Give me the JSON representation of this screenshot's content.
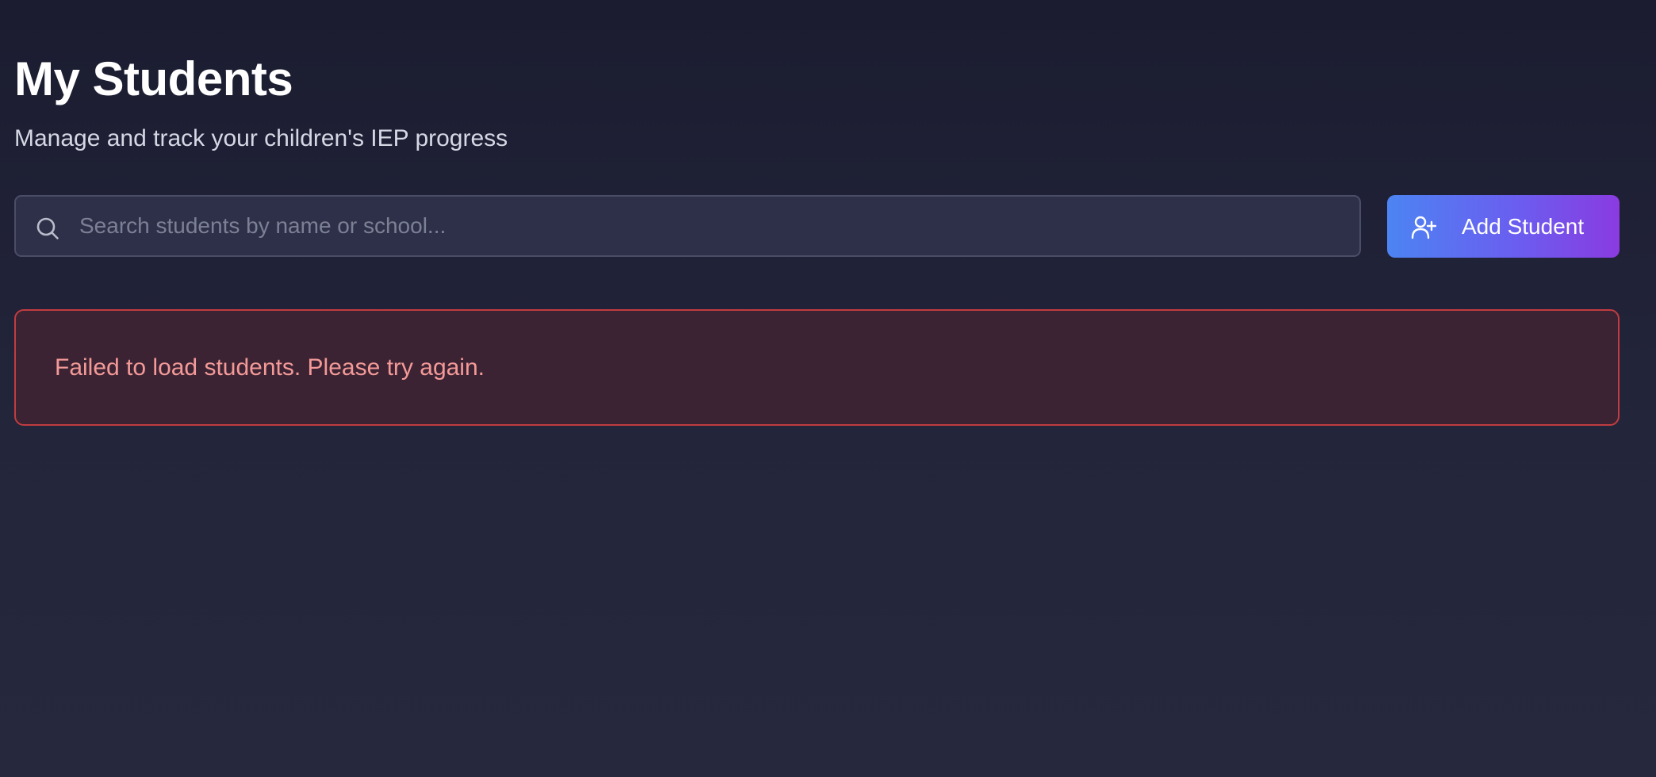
{
  "header": {
    "title": "My Students",
    "subtitle": "Manage and track your children's IEP progress"
  },
  "search": {
    "placeholder": "Search students by name or school...",
    "value": "",
    "icon": "search-icon"
  },
  "actions": {
    "add_label": "Add Student",
    "add_icon": "user-plus-icon"
  },
  "error": {
    "message": "Failed to load students. Please try again."
  },
  "colors": {
    "background": "#1e1f33",
    "error_border": "#c23c40",
    "error_text": "#f39a98",
    "button_gradient_start": "#4c84f2",
    "button_gradient_end": "#8a3be0"
  }
}
